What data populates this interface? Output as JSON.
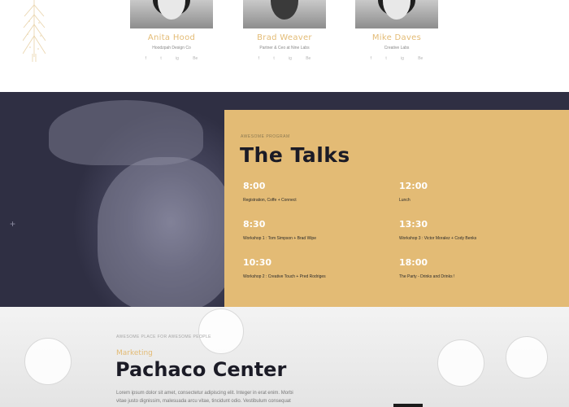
{
  "speakers": [
    {
      "name": "Anita Hood",
      "role": "Hoodzpah Design Co",
      "socials": [
        "f",
        "t",
        "ig",
        "Be"
      ]
    },
    {
      "name": "Brad Weaver",
      "role": "Partner & Ceo at Nine Labs",
      "socials": [
        "f",
        "t",
        "ig",
        "Be"
      ]
    },
    {
      "name": "Mike Daves",
      "role": "Creative Labs",
      "socials": [
        "f",
        "t",
        "ig",
        "Be"
      ]
    }
  ],
  "talks": {
    "eyebrow": "AWESOME PROGRAM",
    "title": "The Talks",
    "slots": [
      {
        "time": "8:00",
        "desc": "Registration, Coffe + Connect"
      },
      {
        "time": "12:00",
        "desc": "Lunch"
      },
      {
        "time": "8:30",
        "desc": "Workshop 1 : Tom Simpson + Brad Wipe"
      },
      {
        "time": "13:30",
        "desc": "Workshop 3 : Victor Moralez + Cody Benks"
      },
      {
        "time": "10:30",
        "desc": "Workshop 2 : Creative Touch + Pred Rodriges"
      },
      {
        "time": "18:00",
        "desc": "The Party - Drinks and Drinks !"
      }
    ]
  },
  "venue": {
    "eyebrow": "AWESOME PLACE FOR AWESOME PEOPLE",
    "kicker": "Marketing",
    "heading": "Pachaco Center",
    "body": "Lorem ipsum dolor sit amet, consectetur adipiscing elit. Integer in erat enim. Morbi vitae justo dignissim, malesuada arcu vitae, tincidunt odio. Vestibulum consequat aliquet nulla,"
  },
  "colors": {
    "accent": "#e3bb75",
    "dark": "#1b1b26",
    "navy": "#2f2f43"
  }
}
